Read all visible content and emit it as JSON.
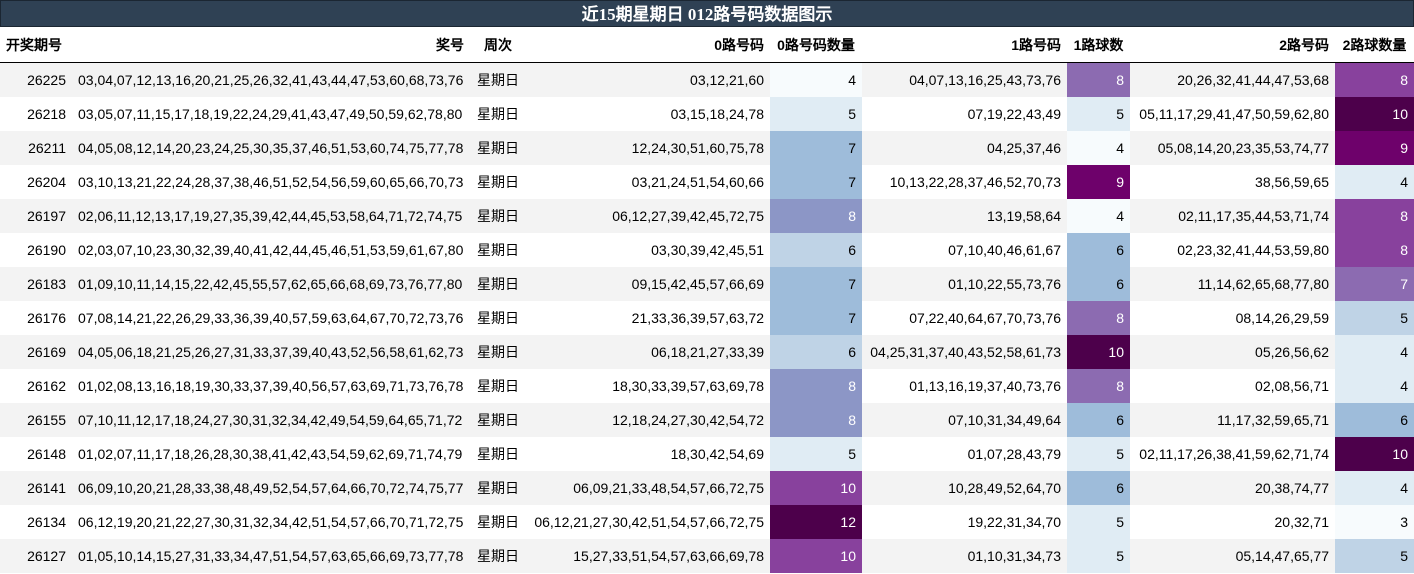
{
  "title": "近15期星期日 012路号码数据图示",
  "chart_data": {
    "type": "table",
    "columns": [
      "开奖期号",
      "奖号",
      "周次",
      "0路号码",
      "0路号码数量",
      "1路号码",
      "1路球数",
      "2路号码",
      "2路球数量"
    ],
    "rows": [
      [
        "26225",
        "03,04,07,12,13,16,20,21,25,26,32,41,43,44,47,53,60,68,73,76",
        "星期日",
        "03,12,21,60",
        4,
        "04,07,13,16,25,43,73,76",
        8,
        "20,26,32,41,44,47,53,68",
        8
      ],
      [
        "26218",
        "03,05,07,11,15,17,18,19,22,24,29,41,43,47,49,50,59,62,78,80",
        "星期日",
        "03,15,18,24,78",
        5,
        "07,19,22,43,49",
        5,
        "05,11,17,29,41,47,50,59,62,80",
        10
      ],
      [
        "26211",
        "04,05,08,12,14,20,23,24,25,30,35,37,46,51,53,60,74,75,77,78",
        "星期日",
        "12,24,30,51,60,75,78",
        7,
        "04,25,37,46",
        4,
        "05,08,14,20,23,35,53,74,77",
        9
      ],
      [
        "26204",
        "03,10,13,21,22,24,28,37,38,46,51,52,54,56,59,60,65,66,70,73",
        "星期日",
        "03,21,24,51,54,60,66",
        7,
        "10,13,22,28,37,46,52,70,73",
        9,
        "38,56,59,65",
        4
      ],
      [
        "26197",
        "02,06,11,12,13,17,19,27,35,39,42,44,45,53,58,64,71,72,74,75",
        "星期日",
        "06,12,27,39,42,45,72,75",
        8,
        "13,19,58,64",
        4,
        "02,11,17,35,44,53,71,74",
        8
      ],
      [
        "26190",
        "02,03,07,10,23,30,32,39,40,41,42,44,45,46,51,53,59,61,67,80",
        "星期日",
        "03,30,39,42,45,51",
        6,
        "07,10,40,46,61,67",
        6,
        "02,23,32,41,44,53,59,80",
        8
      ],
      [
        "26183",
        "01,09,10,11,14,15,22,42,45,55,57,62,65,66,68,69,73,76,77,80",
        "星期日",
        "09,15,42,45,57,66,69",
        7,
        "01,10,22,55,73,76",
        6,
        "11,14,62,65,68,77,80",
        7
      ],
      [
        "26176",
        "07,08,14,21,22,26,29,33,36,39,40,57,59,63,64,67,70,72,73,76",
        "星期日",
        "21,33,36,39,57,63,72",
        7,
        "07,22,40,64,67,70,73,76",
        8,
        "08,14,26,29,59",
        5
      ],
      [
        "26169",
        "04,05,06,18,21,25,26,27,31,33,37,39,40,43,52,56,58,61,62,73",
        "星期日",
        "06,18,21,27,33,39",
        6,
        "04,25,31,37,40,43,52,58,61,73",
        10,
        "05,26,56,62",
        4
      ],
      [
        "26162",
        "01,02,08,13,16,18,19,30,33,37,39,40,56,57,63,69,71,73,76,78",
        "星期日",
        "18,30,33,39,57,63,69,78",
        8,
        "01,13,16,19,37,40,73,76",
        8,
        "02,08,56,71",
        4
      ],
      [
        "26155",
        "07,10,11,12,17,18,24,27,30,31,32,34,42,49,54,59,64,65,71,72",
        "星期日",
        "12,18,24,27,30,42,54,72",
        8,
        "07,10,31,34,49,64",
        6,
        "11,17,32,59,65,71",
        6
      ],
      [
        "26148",
        "01,02,07,11,17,18,26,28,30,38,41,42,43,54,59,62,69,71,74,79",
        "星期日",
        "18,30,42,54,69",
        5,
        "01,07,28,43,79",
        5,
        "02,11,17,26,38,41,59,62,71,74",
        10
      ],
      [
        "26141",
        "06,09,10,20,21,28,33,38,48,49,52,54,57,64,66,70,72,74,75,77",
        "星期日",
        "06,09,21,33,48,54,57,66,72,75",
        10,
        "10,28,49,52,64,70",
        6,
        "20,38,74,77",
        4
      ],
      [
        "26134",
        "06,12,19,20,21,22,27,30,31,32,34,42,51,54,57,66,70,71,72,75",
        "星期日",
        "06,12,21,27,30,42,51,54,57,66,72,75",
        12,
        "19,22,31,34,70",
        5,
        "20,32,71",
        3
      ],
      [
        "26127",
        "01,05,10,14,15,27,31,33,34,47,51,54,57,63,65,66,69,73,77,78",
        "星期日",
        "15,27,33,51,54,57,63,66,69,78",
        10,
        "01,10,31,34,73",
        5,
        "05,14,47,65,77",
        5
      ]
    ]
  },
  "colors": {
    "title_bg": "#2f4154",
    "scale": [
      "#f7fbfd",
      "#e0ecf4",
      "#bfd3e6",
      "#9ebcda",
      "#8c96c6",
      "#8c6bb1",
      "#88419d",
      "#6e016b",
      "#4d004b"
    ]
  }
}
